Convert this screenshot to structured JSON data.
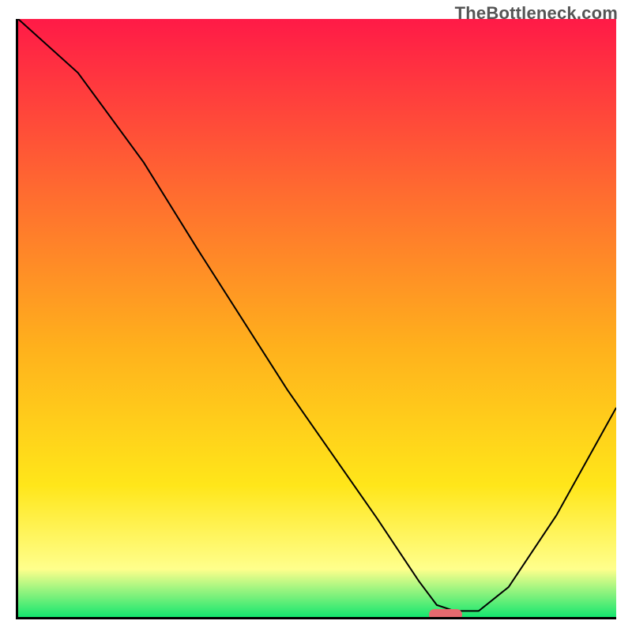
{
  "watermark": "TheBottleneck.com",
  "colors": {
    "top": "#ff1a47",
    "upper_mid": "#ff6e2f",
    "mid": "#ffb11c",
    "lower_mid": "#ffe61a",
    "soft_yellow": "#ffff8c",
    "green": "#15e66f",
    "marker": "#e56a6f",
    "axis": "#000000"
  },
  "chart_data": {
    "type": "line",
    "title": "",
    "xlabel": "",
    "ylabel": "",
    "xlim": [
      0,
      100
    ],
    "ylim": [
      0,
      100
    ],
    "series": [
      {
        "name": "bottleneck-curve",
        "x": [
          0,
          10,
          21,
          30,
          45,
          60,
          67,
          70,
          73,
          77,
          82,
          90,
          100
        ],
        "values": [
          100,
          91,
          76,
          61.5,
          38,
          16.5,
          6,
          2,
          1,
          1,
          5,
          17,
          35
        ]
      }
    ],
    "annotations": [
      {
        "name": "optimal-marker",
        "x": 71.5,
        "y": 0.4
      }
    ],
    "gradient_stops": [
      {
        "offset": 0.0,
        "key": "top"
      },
      {
        "offset": 0.3,
        "key": "upper_mid"
      },
      {
        "offset": 0.55,
        "key": "mid"
      },
      {
        "offset": 0.78,
        "key": "lower_mid"
      },
      {
        "offset": 0.92,
        "key": "soft_yellow"
      },
      {
        "offset": 1.0,
        "key": "green"
      }
    ]
  }
}
